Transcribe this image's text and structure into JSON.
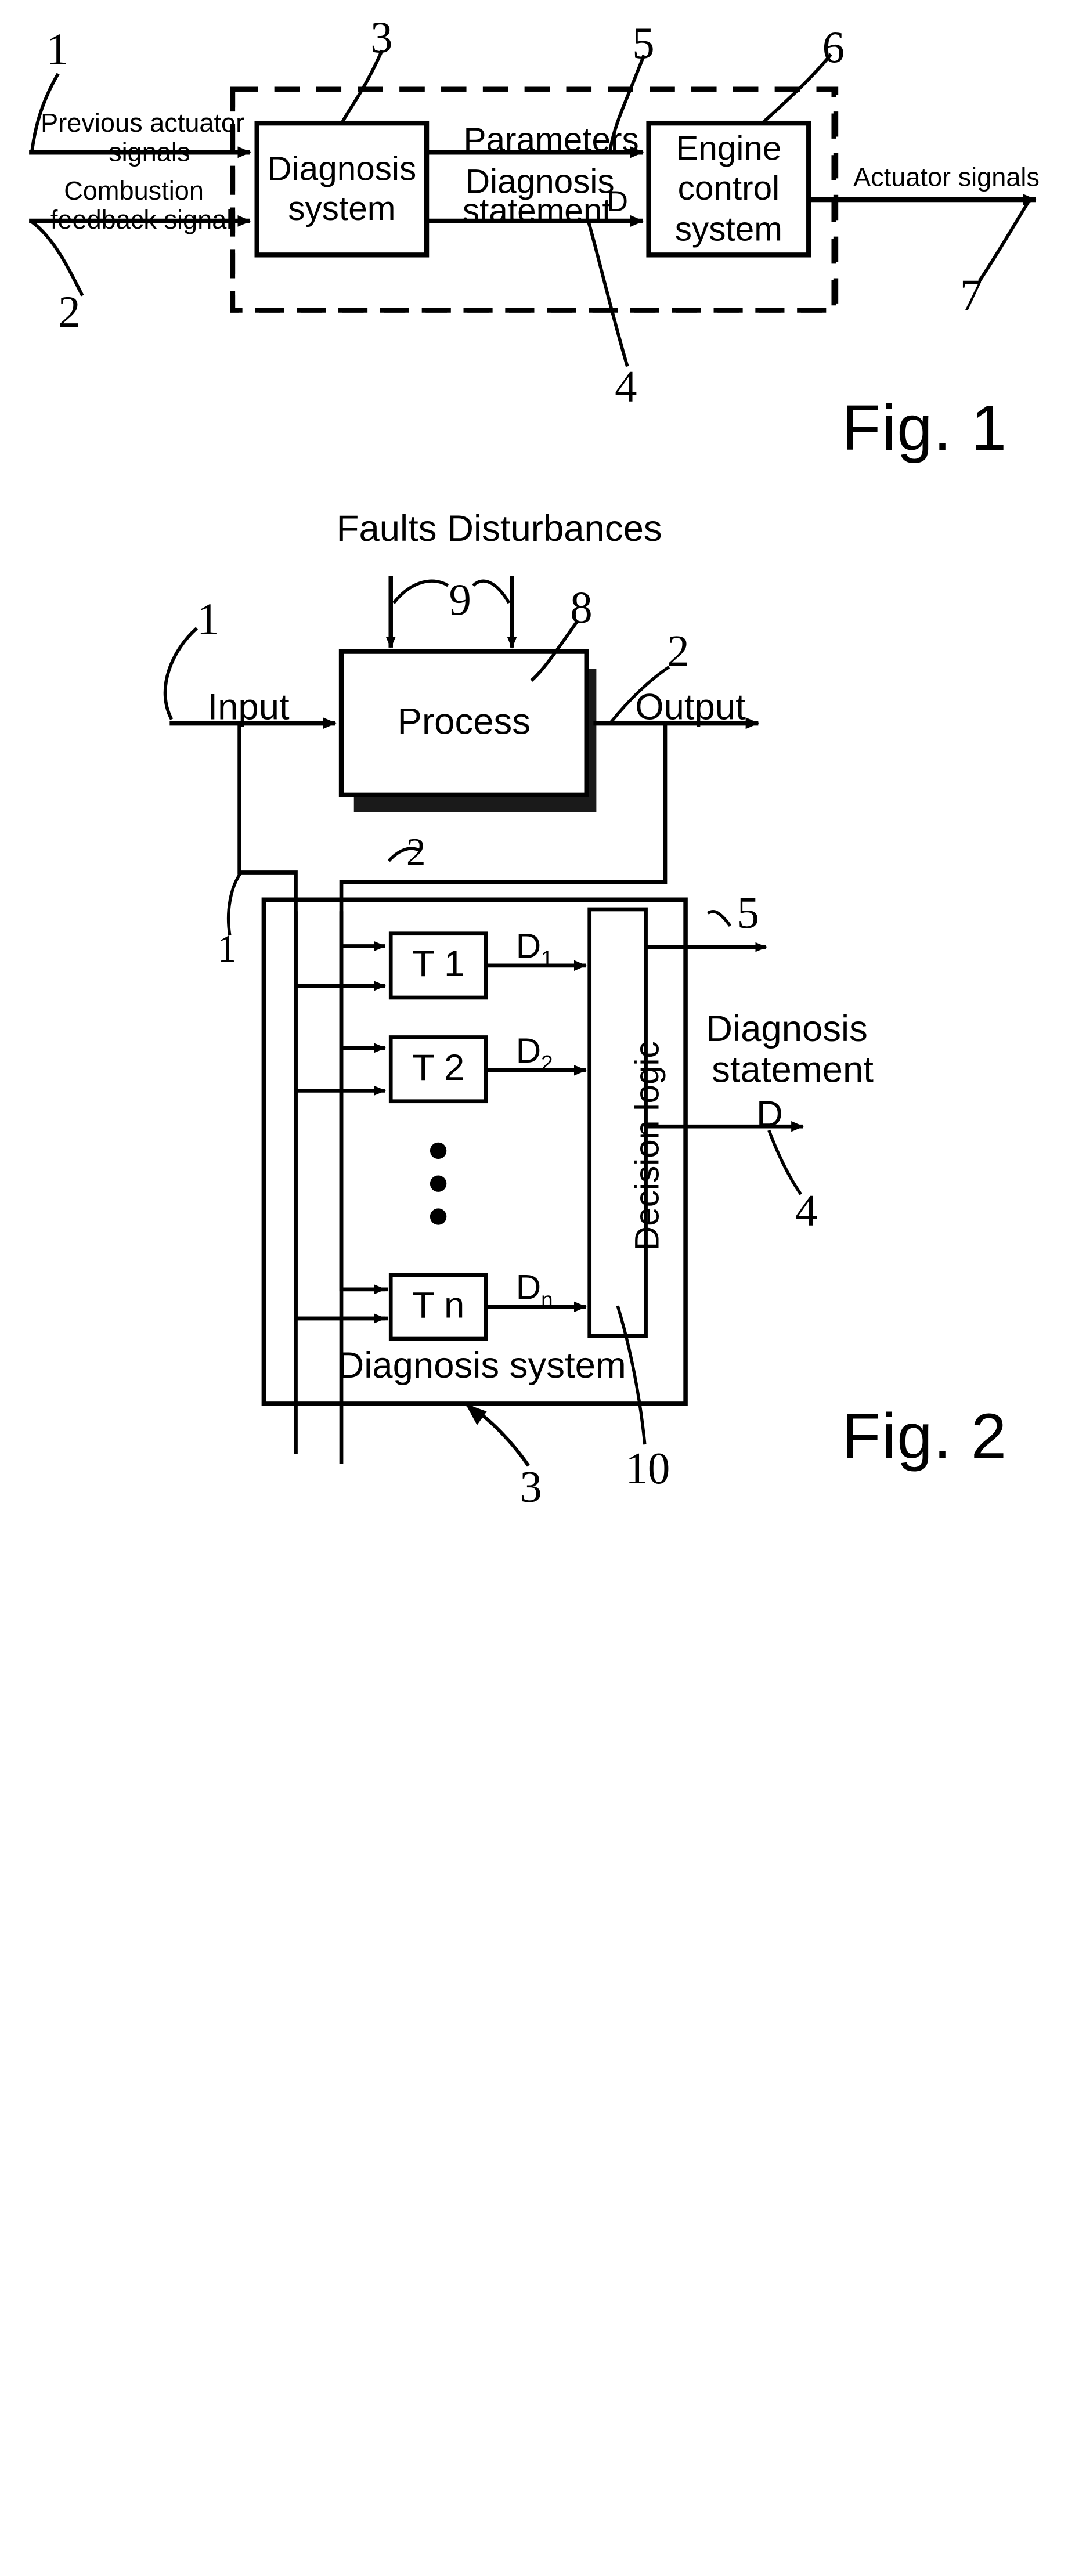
{
  "figure1": {
    "caption": "Fig. 1",
    "inputs": [
      {
        "line1": "Previous actuator",
        "line2": "signals",
        "ref": "1"
      },
      {
        "line1": "Combustion",
        "line2": "feedback signal",
        "ref": "2"
      }
    ],
    "blocks": [
      {
        "id": "diagnosis-system",
        "line1": "Diagnosis",
        "line2": "system",
        "ref": "3"
      },
      {
        "id": "engine-control-system",
        "line1": "Engine",
        "line2": "control",
        "line3": "system",
        "ref": "6"
      }
    ],
    "signals": [
      {
        "id": "parameters",
        "label": "Parameters",
        "ref": "5"
      },
      {
        "id": "diagnosis-statement",
        "line1": "Diagnosis",
        "line2": "statement",
        "symbol": "D",
        "ref": "4"
      }
    ],
    "output": {
      "label": "Actuator signals",
      "ref": "7"
    },
    "enclosure_ref": ""
  },
  "figure2": {
    "caption": "Fig. 2",
    "title": "Faults Disturbances",
    "disturbance_ref": "9",
    "process": {
      "label": "Process",
      "ref": "8"
    },
    "input": {
      "label": "Input",
      "ref": "1"
    },
    "output": {
      "label": "Output",
      "ref": "2"
    },
    "tap_input_ref": "1",
    "tap_output_ref": "2",
    "tests": [
      {
        "name": "T 1",
        "signal": "D",
        "sub": "1"
      },
      {
        "name": "T 2",
        "signal": "D",
        "sub": "2"
      },
      {
        "name": "T n",
        "signal": "D",
        "sub": "n"
      }
    ],
    "ellipsis_dots": 3,
    "decision_logic": {
      "label": "Decision logic",
      "ref": "10"
    },
    "top_output_ref": "5",
    "diagnosis_statement": {
      "line1": "Diagnosis",
      "line2": "statement",
      "symbol": "D",
      "ref": "4"
    },
    "system_label": "Diagnosis system",
    "system_ref": "3"
  },
  "colors": {
    "ink": "#000000",
    "paper": "#ffffff"
  }
}
